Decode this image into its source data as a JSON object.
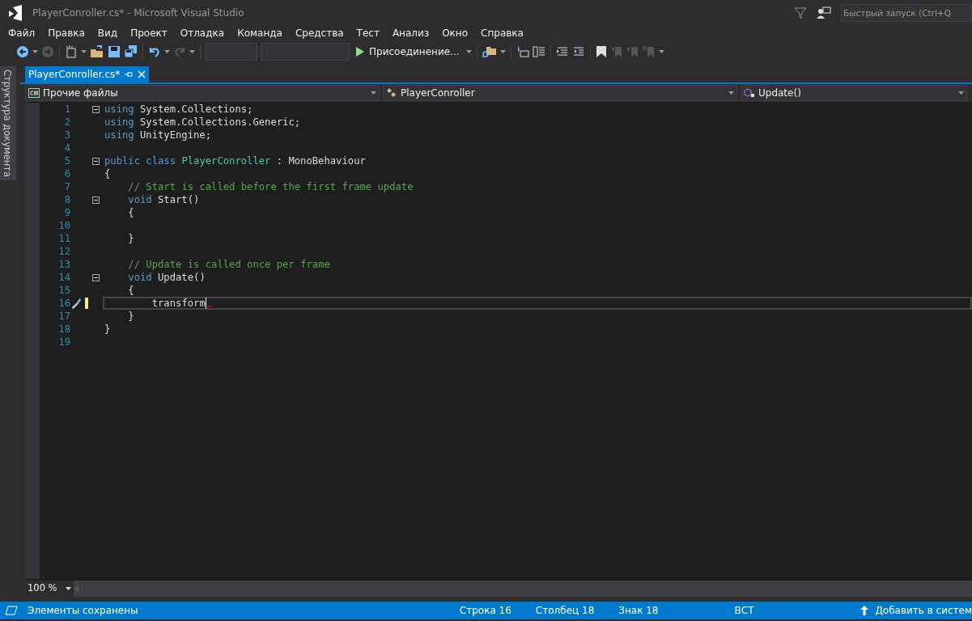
{
  "window": {
    "title": "PlayerConroller.cs* - Microsoft Visual Studio"
  },
  "quick_launch": {
    "placeholder": "Быстрый запуск (Ctrl+Q"
  },
  "menu": [
    "Файл",
    "Правка",
    "Вид",
    "Проект",
    "Отладка",
    "Команда",
    "Средства",
    "Тест",
    "Анализ",
    "Окно",
    "Справка"
  ],
  "toolbar": {
    "start_button": "Присоединение..."
  },
  "side_tab": "Структура документа",
  "tabs": [
    {
      "label": "PlayerConroller.cs*",
      "selected": true
    }
  ],
  "nav_bar": {
    "project": "Прочие файлы",
    "class": "PlayerConroller",
    "member": "Update()"
  },
  "editor": {
    "lines": [
      {
        "number": "1",
        "fold": true,
        "tokens": [
          {
            "kind": "keyword",
            "text": "using"
          },
          {
            "kind": "plain",
            "text": "System.Collections;"
          }
        ]
      },
      {
        "number": "2",
        "tokens": [
          {
            "kind": "keyword",
            "text": "using"
          },
          {
            "kind": "plain",
            "text": "System.Collections.Generic;"
          }
        ]
      },
      {
        "number": "3",
        "tokens": [
          {
            "kind": "keyword",
            "text": "using"
          },
          {
            "kind": "plain",
            "text": "UnityEngine;"
          }
        ]
      },
      {
        "number": "4"
      },
      {
        "number": "5",
        "fold": true,
        "tokens": [
          {
            "kind": "keyword",
            "text": "public class"
          },
          {
            "kind": "type",
            "text": "PlayerConroller"
          },
          {
            "kind": "plain",
            "text": ": MonoBehaviour"
          }
        ]
      },
      {
        "number": "6",
        "tokens": [
          {
            "kind": "plain",
            "text": "{"
          }
        ]
      },
      {
        "number": "7",
        "tokens": [
          {
            "kind": "comment",
            "text": "    // Start is called before the first frame update"
          }
        ]
      },
      {
        "number": "8",
        "fold": true,
        "tokens": [
          {
            "kind": "keyword",
            "text": "    void"
          },
          {
            "kind": "plain",
            "text": "Start()"
          }
        ]
      },
      {
        "number": "9",
        "tokens": [
          {
            "kind": "plain",
            "text": "    {"
          }
        ]
      },
      {
        "number": "10"
      },
      {
        "number": "11",
        "tokens": [
          {
            "kind": "plain",
            "text": "    }"
          }
        ]
      },
      {
        "number": "12"
      },
      {
        "number": "13",
        "tokens": [
          {
            "kind": "comment",
            "text": "    // Update is called once per frame"
          }
        ]
      },
      {
        "number": "14",
        "fold": true,
        "tokens": [
          {
            "kind": "keyword",
            "text": "    void"
          },
          {
            "kind": "plain",
            "text": "Update()"
          }
        ]
      },
      {
        "number": "15",
        "tokens": [
          {
            "kind": "plain",
            "text": "    {"
          }
        ]
      },
      {
        "number": "16",
        "current": true,
        "modified": true,
        "tokens": [
          {
            "kind": "plain",
            "text": "        transform"
          }
        ]
      },
      {
        "number": "17",
        "tokens": [
          {
            "kind": "plain",
            "text": "    }"
          }
        ]
      },
      {
        "number": "18",
        "tokens": [
          {
            "kind": "plain",
            "text": "}"
          }
        ]
      },
      {
        "number": "19"
      }
    ],
    "zoom": "100 %"
  },
  "status_bar": {
    "message": "Элементы сохранены",
    "line": "Строка 16",
    "column": "Столбец 18",
    "char": "Знак 18",
    "mode": "ВСТ",
    "publish": "Добавить в систем"
  }
}
